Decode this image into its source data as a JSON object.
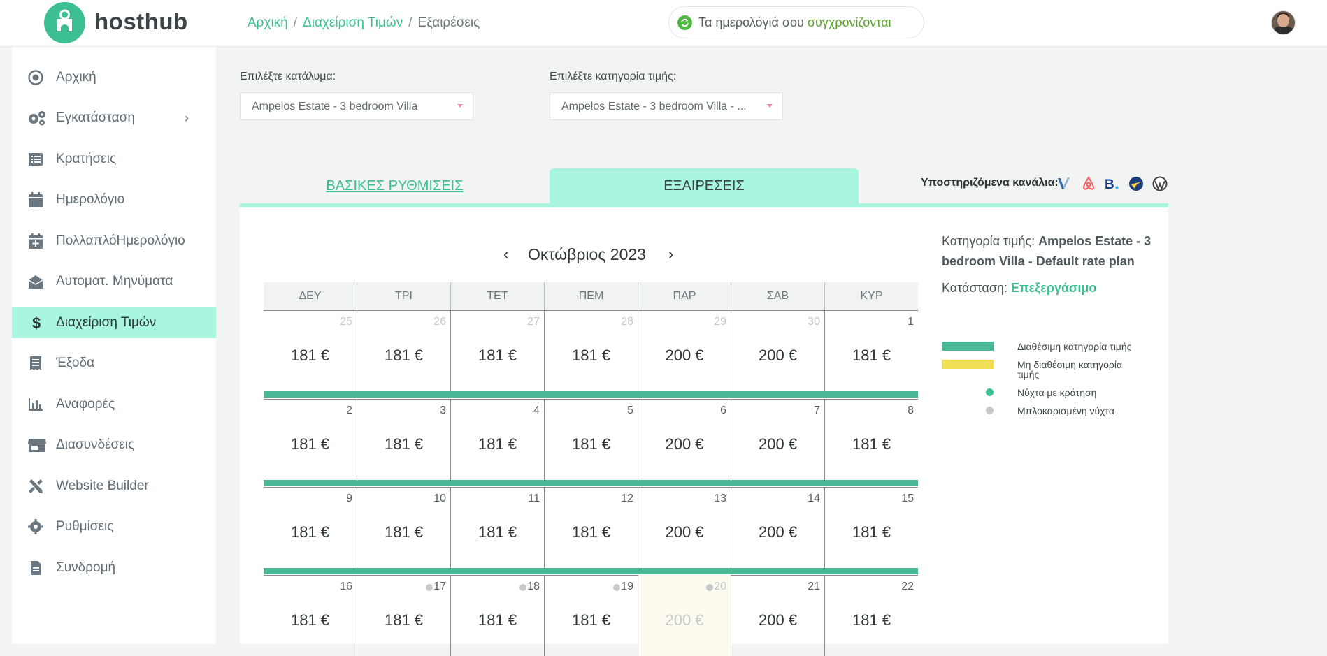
{
  "app": {
    "name": "hosthub"
  },
  "breadcrumb": [
    {
      "label": "Αρχική"
    },
    {
      "label": "Διαχείριση Τιμών"
    },
    {
      "label": "Εξαιρέσεις"
    }
  ],
  "sync": {
    "prefix": "Τα ημερολόγιά σου ",
    "highlight": "συγχρονίζονται"
  },
  "sidebar": {
    "items": [
      {
        "label": "Αρχική",
        "icon": "target-icon"
      },
      {
        "label": "Εγκατάσταση",
        "icon": "gears-icon",
        "has_chevron": true
      },
      {
        "label": "Κρατήσεις",
        "icon": "list-icon"
      },
      {
        "label": "Ημερολόγιο",
        "icon": "calendar-icon"
      },
      {
        "label": "ΠολλαπλόΗμερολόγιο",
        "icon": "calendar-plus-icon"
      },
      {
        "label": "Αυτοματ. Μηνύματα",
        "icon": "envelope-open-icon"
      },
      {
        "label": "Διαχείριση Τιμών",
        "icon": "dollar-icon",
        "active": true
      },
      {
        "label": "Έξοδα",
        "icon": "receipt-icon"
      },
      {
        "label": "Αναφορές",
        "icon": "bar-chart-icon"
      },
      {
        "label": "Διασυνδέσεις",
        "icon": "store-icon"
      },
      {
        "label": "Website Builder",
        "icon": "tools-icon"
      },
      {
        "label": "Ρυθμίσεις",
        "icon": "gear-icon"
      },
      {
        "label": "Συνδρομή",
        "icon": "document-icon"
      }
    ]
  },
  "selectors": {
    "property": {
      "label": "Επιλέξτε κατάλυμα:",
      "value": "Ampelos Estate - 3 bedroom Villa"
    },
    "rate": {
      "label": "Επιλέξτε κατηγορία τιμής:",
      "value": "Ampelos Estate - 3 bedroom Villa - ..."
    }
  },
  "tabs": {
    "basic": "ΒΑΣΙΚΕΣ ΡΥΘΜΙΣΕΙΣ",
    "exceptions": "ΕΞΑΙΡΕΣΕΙΣ"
  },
  "channels": {
    "label": "Υποστηριζόμενα κανάλια:",
    "icons": [
      "vrbo-icon",
      "airbnb-icon",
      "booking-icon",
      "expedia-icon",
      "wordpress-icon"
    ]
  },
  "calendar": {
    "month": "Οκτώβριος 2023",
    "weekdays": [
      "ΔΕΥ",
      "ΤΡΙ",
      "ΤΕΤ",
      "ΠΕΜ",
      "ΠΑΡ",
      "ΣΑΒ",
      "ΚΥΡ"
    ],
    "weeks": [
      [
        {
          "day": "25",
          "price": "181 €",
          "prev": true
        },
        {
          "day": "26",
          "price": "181 €",
          "prev": true
        },
        {
          "day": "27",
          "price": "181 €",
          "prev": true
        },
        {
          "day": "28",
          "price": "181 €",
          "prev": true
        },
        {
          "day": "29",
          "price": "200 €",
          "prev": true
        },
        {
          "day": "30",
          "price": "200 €",
          "prev": true
        },
        {
          "day": "1",
          "price": "181 €"
        }
      ],
      [
        {
          "day": "2",
          "price": "181 €"
        },
        {
          "day": "3",
          "price": "181 €"
        },
        {
          "day": "4",
          "price": "181 €"
        },
        {
          "day": "5",
          "price": "181 €"
        },
        {
          "day": "6",
          "price": "200 €"
        },
        {
          "day": "7",
          "price": "200 €"
        },
        {
          "day": "8",
          "price": "181 €"
        }
      ],
      [
        {
          "day": "9",
          "price": "181 €"
        },
        {
          "day": "10",
          "price": "181 €"
        },
        {
          "day": "11",
          "price": "181 €"
        },
        {
          "day": "12",
          "price": "181 €"
        },
        {
          "day": "13",
          "price": "200 €"
        },
        {
          "day": "14",
          "price": "200 €"
        },
        {
          "day": "15",
          "price": "181 €"
        }
      ],
      [
        {
          "day": "16",
          "price": "181 €"
        },
        {
          "day": "17",
          "price": "181 €",
          "blocked": true
        },
        {
          "day": "18",
          "price": "181 €",
          "blocked": true
        },
        {
          "day": "19",
          "price": "181 €",
          "blocked": true
        },
        {
          "day": "20",
          "price": "200 €",
          "blocked": true,
          "faded": true
        },
        {
          "day": "21",
          "price": "200 €"
        },
        {
          "day": "22",
          "price": "181 €"
        }
      ]
    ]
  },
  "info": {
    "rate_label": "Κατηγορία τιμής: ",
    "rate_value": "Ampelos Estate - 3 bedroom Villa - Default rate plan",
    "status_label": "Κατάσταση: ",
    "status_value": "Επεξεργάσιμο"
  },
  "legend": [
    {
      "label": "Διαθέσιμη κατηγορία τιμής",
      "color": "#4ab896",
      "shape": "bar"
    },
    {
      "label": "Μη διαθέσιμη κατηγορία τιμής",
      "color": "#f0df55",
      "shape": "bar"
    },
    {
      "label": "Νύχτα με κράτηση",
      "color": "#3cbf93",
      "shape": "dot"
    },
    {
      "label": "Μπλοκαρισμένη νύχτα",
      "color": "#c6c9ca",
      "shape": "dot"
    }
  ]
}
